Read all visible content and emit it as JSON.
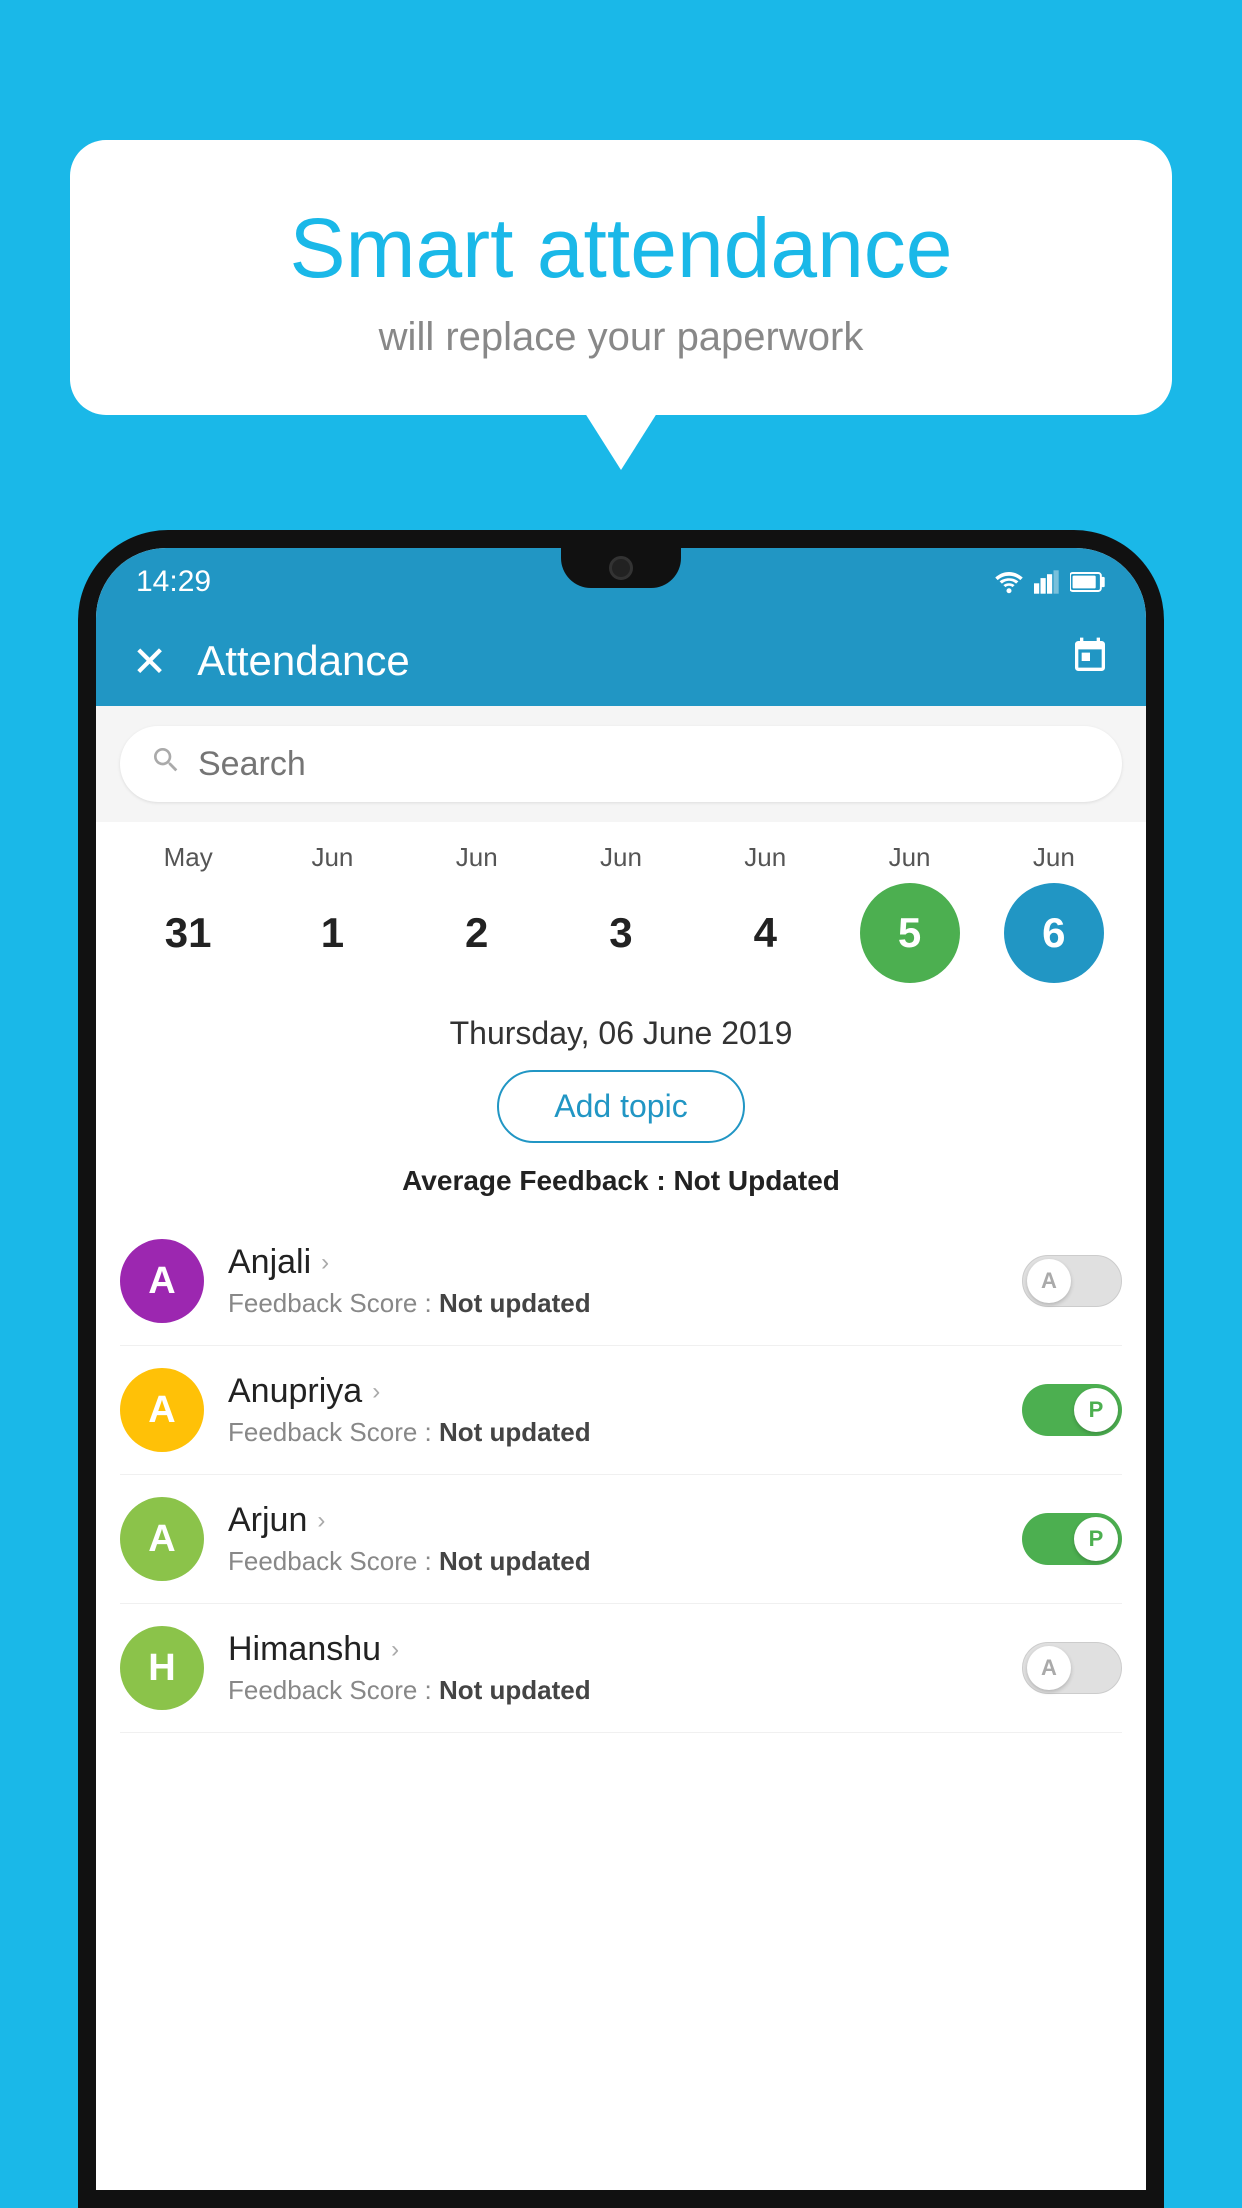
{
  "background_color": "#1ab8e8",
  "bubble": {
    "title": "Smart attendance",
    "subtitle": "will replace your paperwork"
  },
  "status_bar": {
    "time": "14:29"
  },
  "header": {
    "title": "Attendance",
    "close_label": "✕",
    "calendar_icon": "📅"
  },
  "search": {
    "placeholder": "Search"
  },
  "calendar": {
    "months": [
      "May",
      "Jun",
      "Jun",
      "Jun",
      "Jun",
      "Jun",
      "Jun"
    ],
    "dates": [
      "31",
      "1",
      "2",
      "3",
      "4",
      "5",
      "6"
    ],
    "states": [
      "normal",
      "normal",
      "normal",
      "normal",
      "normal",
      "today",
      "selected"
    ]
  },
  "selected_date_label": "Thursday, 06 June 2019",
  "add_topic_label": "Add topic",
  "avg_feedback_label": "Average Feedback : ",
  "avg_feedback_value": "Not Updated",
  "students": [
    {
      "name": "Anjali",
      "avatar_letter": "A",
      "avatar_color": "#9c27b0",
      "feedback_label": "Feedback Score : ",
      "feedback_value": "Not updated",
      "toggle_state": "off",
      "toggle_letter": "A"
    },
    {
      "name": "Anupriya",
      "avatar_letter": "A",
      "avatar_color": "#ffc107",
      "feedback_label": "Feedback Score : ",
      "feedback_value": "Not updated",
      "toggle_state": "on",
      "toggle_letter": "P"
    },
    {
      "name": "Arjun",
      "avatar_letter": "A",
      "avatar_color": "#8bc34a",
      "feedback_label": "Feedback Score : ",
      "feedback_value": "Not updated",
      "toggle_state": "on",
      "toggle_letter": "P"
    },
    {
      "name": "Himanshu",
      "avatar_letter": "H",
      "avatar_color": "#8bc34a",
      "feedback_label": "Feedback Score : ",
      "feedback_value": "Not updated",
      "toggle_state": "off",
      "toggle_letter": "A"
    }
  ]
}
